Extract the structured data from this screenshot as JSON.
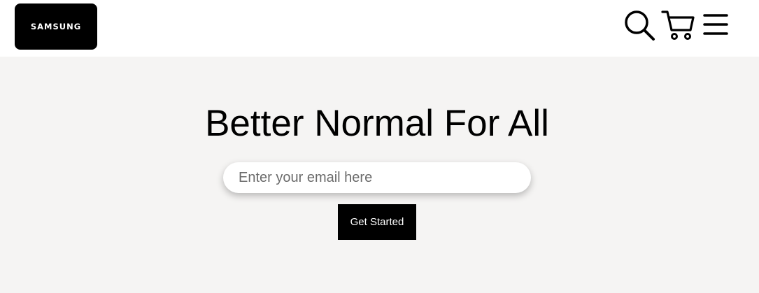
{
  "header": {
    "logo_text": "SAMSUNG",
    "icons": {
      "search": "search-icon",
      "cart": "cart-icon",
      "menu": "hamburger-menu-icon"
    }
  },
  "hero": {
    "title": "Better Normal For All",
    "email_placeholder": "Enter your email here",
    "email_value": "",
    "cta_label": "Get Started"
  },
  "colors": {
    "brand": "#000000",
    "header_background": "#ffffff",
    "hero_background": "#f5f4f3",
    "button_text": "#ffffff"
  }
}
